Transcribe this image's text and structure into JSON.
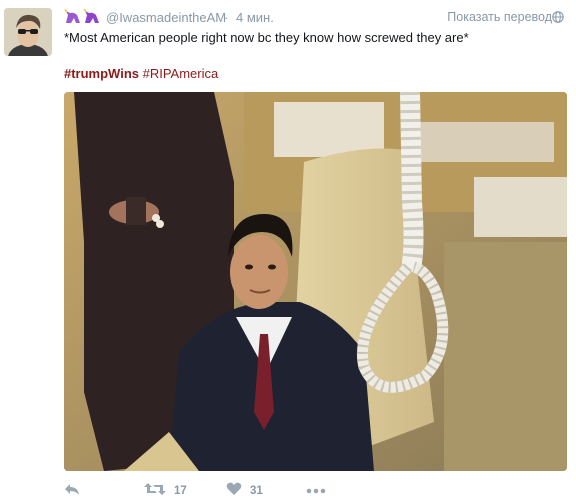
{
  "tweet": {
    "handle": "@IwasmadeintheAM",
    "separator": "·",
    "time": "4 мин.",
    "translate_label": "Показать перевод",
    "text": "*Most American people right now bc they know how screwed they are*",
    "hashtags": [
      "#trumpWins",
      "#RIPAmerica"
    ]
  },
  "actions": {
    "retweets": "17",
    "likes": "31"
  },
  "icons": {
    "unicorn_emoji": "unicorn-icon",
    "globe": "globe-icon",
    "reply": "reply-icon",
    "retweet": "retweet-icon",
    "like": "heart-icon",
    "more": "more-icon"
  },
  "colors": {
    "hashtag": "#8b1a1a",
    "muted": "#8899a6",
    "text": "#14171a"
  }
}
